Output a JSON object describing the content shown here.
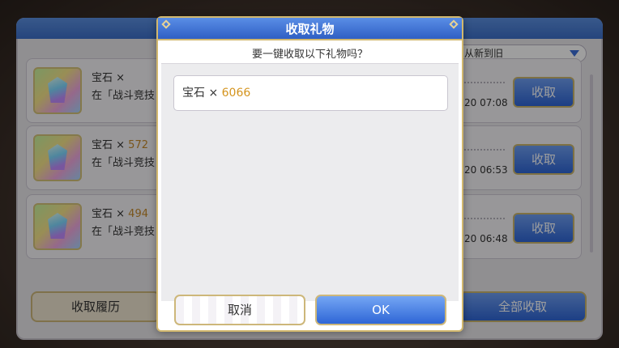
{
  "background": {
    "sort_label": "从新到旧",
    "rows": [
      {
        "item": "宝石 × ",
        "amount": "",
        "desc": "在「战斗竞技",
        "time": "20 07:08",
        "button": "收取"
      },
      {
        "item": "宝石 × ",
        "amount": "572",
        "desc": "在「战斗竞技",
        "time": "20 06:53",
        "button": "收取"
      },
      {
        "item": "宝石 × ",
        "amount": "494",
        "desc": "在「战斗竞技",
        "time": "20 06:48",
        "button": "收取"
      }
    ],
    "history_button": "收取履历",
    "receive_all_button": "全部收取"
  },
  "modal": {
    "title": "收取礼物",
    "subtitle": "要一键收取以下礼物吗？",
    "item_label": "宝石 × ",
    "item_amount": "6066",
    "cancel_label": "取消",
    "ok_label": "OK"
  },
  "colors": {
    "header_blue": "#2f5fc4",
    "button_blue": "#2f66d6",
    "gold_border": "#cdb77a",
    "amount_orange": "#d4941e"
  }
}
